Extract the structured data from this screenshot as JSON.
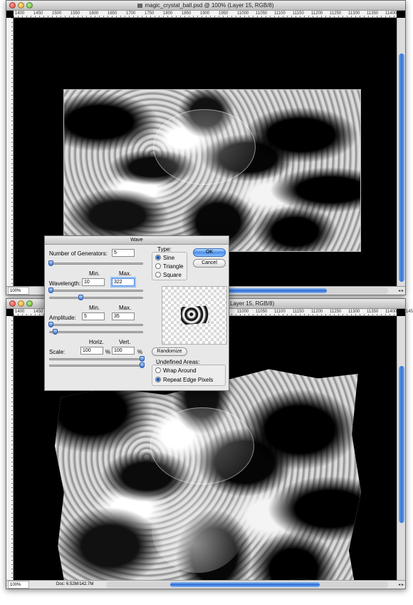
{
  "window_top": {
    "title": "magic_crystal_ball.psd @ 100% (Layer 15, RGB/8)",
    "ruler_ticks": [
      "1400",
      "1450",
      "1500",
      "1550",
      "1600",
      "1650",
      "1700",
      "1750",
      "1800",
      "1850",
      "1900",
      "1950",
      "11000",
      "11050",
      "11100",
      "11150",
      "11200",
      "11250",
      "11300",
      "11350",
      "11400"
    ],
    "zoom": "100%"
  },
  "window_bottom": {
    "title": "Layer 15, RGB/8)",
    "ruler_ticks": [
      "1400",
      "1450",
      "1500",
      "1550",
      "1600",
      "1650",
      "1700",
      "1750",
      "1800",
      "1850",
      "1900",
      "1950",
      "11000",
      "11050",
      "11100",
      "11150",
      "11200",
      "11250",
      "11300",
      "11350",
      "11400",
      "11450"
    ],
    "zoom": "100%",
    "doc_info": "Doc: 6.52M/142.7M"
  },
  "dialog": {
    "title": "Wave",
    "generators_label": "Number of Generators:",
    "generators_value": "5",
    "min_label": "Min.",
    "max_label": "Max.",
    "wavelength_label": "Wavelength:",
    "wavelength_min": "10",
    "wavelength_max": "322",
    "amplitude_label": "Amplitude:",
    "amplitude_min": "5",
    "amplitude_max": "35",
    "horiz_label": "Horiz.",
    "vert_label": "Vert.",
    "scale_label": "Scale:",
    "scale_horiz": "100",
    "scale_vert": "100",
    "percent": "%",
    "type_label": "Type:",
    "type_sine": "Sine",
    "type_triangle": "Triangle",
    "type_square": "Square",
    "ok": "OK",
    "cancel": "Cancel",
    "randomize": "Randomize",
    "undefined_label": "Undefined Areas:",
    "wrap_around": "Wrap Around",
    "repeat_edge": "Repeat Edge Pixels"
  }
}
